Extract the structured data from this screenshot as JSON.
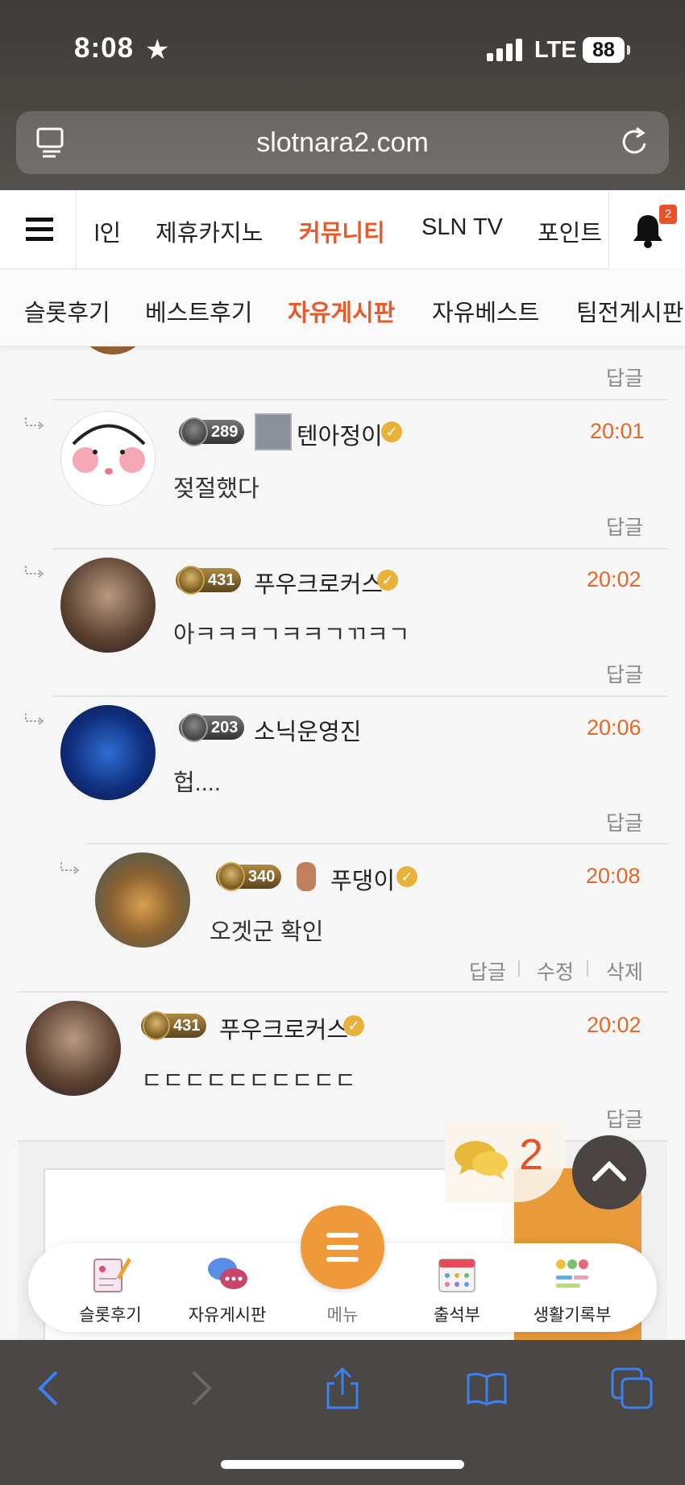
{
  "status_bar": {
    "time": "8:08",
    "network": "LTE",
    "battery": "88"
  },
  "browser": {
    "url": "slotnara2.com"
  },
  "main_nav": {
    "items": [
      "l인",
      "제휴카지노",
      "커뮤니티",
      "SLN TV",
      "포인트"
    ],
    "active": "커뮤니티",
    "notification_count": "2"
  },
  "sub_nav": {
    "items": [
      "슬롯후기",
      "베스트후기",
      "자유게시판",
      "자유베스트",
      "팀전게시판"
    ],
    "active": "자유게시판"
  },
  "comments": [
    {
      "reply_label": "답글"
    },
    {
      "level": "289",
      "nickname": "텐아정이",
      "time": "20:01",
      "text": "젖절했다",
      "reply_label": "답글"
    },
    {
      "level": "431",
      "nickname": "푸우크로커스",
      "time": "20:02",
      "text": "아ㅋㅋㅋㄱㅋㅋㄱㄲㅋㄱ",
      "reply_label": "답글"
    },
    {
      "level": "203",
      "nickname": "소닉운영진",
      "time": "20:06",
      "text": "헙....",
      "reply_label": "답글"
    },
    {
      "level": "340",
      "nickname": "푸댕이",
      "time": "20:08",
      "text": "오겟군 확인",
      "reply_label": "답글",
      "edit_label": "수정",
      "delete_label": "삭제"
    },
    {
      "level": "431",
      "nickname": "푸우크로커스",
      "time": "20:02",
      "text": "ㄷㄷㄷㄷㄷㄷㄷㄷㄷㄷ",
      "reply_label": "답글"
    }
  ],
  "floating": {
    "comment_count": "2"
  },
  "app_bar": {
    "items": [
      "슬롯후기",
      "자유게시판",
      "메뉴",
      "출석부",
      "생활기록부"
    ]
  },
  "colors": {
    "accent": "#e85a2a",
    "time": "#e06a2a",
    "menu": "#ef9a3a"
  }
}
